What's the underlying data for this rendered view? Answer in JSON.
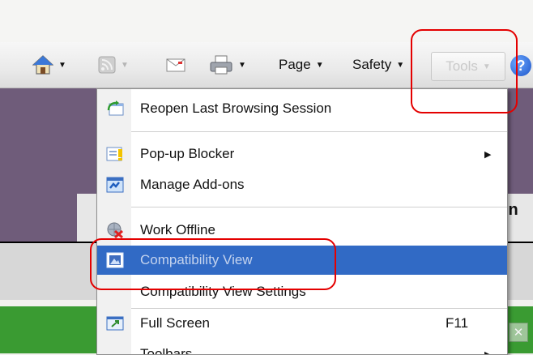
{
  "toolbar": {
    "page_label": "Page",
    "safety_label": "Safety",
    "tools_label": "Tools"
  },
  "page": {
    "partial_heading": "in"
  },
  "menu": {
    "items": [
      {
        "label": "Reopen Last Browsing Session",
        "icon": "reopen-session-icon"
      },
      {
        "label": "Pop-up Blocker",
        "icon": "popup-blocker-icon",
        "submenu": true
      },
      {
        "label": "Manage Add-ons",
        "icon": "manage-addons-icon"
      },
      {
        "label": "Work Offline",
        "icon": "work-offline-icon"
      },
      {
        "label": "Compatibility View",
        "icon": "compatibility-view-icon",
        "selected": true
      },
      {
        "label": "Compatibility View Settings"
      },
      {
        "label": "Full Screen",
        "icon": "full-screen-icon",
        "shortcut": "F11"
      },
      {
        "label": "Toolbars",
        "submenu": true
      }
    ]
  },
  "colors": {
    "selection": "#316ac5",
    "annotation": "#e40000",
    "background_band": "#6f5c7a",
    "status_band": "#3a9b32"
  }
}
